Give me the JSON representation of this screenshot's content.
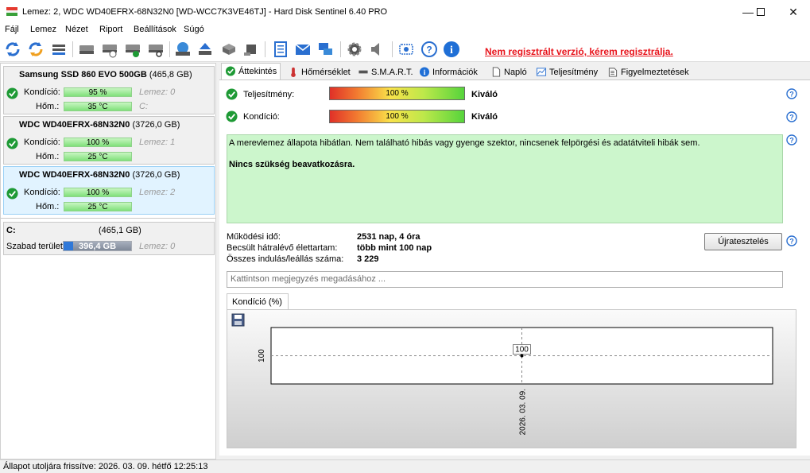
{
  "window": {
    "title": "Lemez: 2, WDC WD40EFRX-68N32N0 [WD-WCC7K3VE46TJ]  -  Hard Disk Sentinel 6.40 PRO"
  },
  "menu": [
    {
      "label": "Fájl"
    },
    {
      "label": "Lemez"
    },
    {
      "label": "Nézet"
    },
    {
      "label": "Riport"
    },
    {
      "label": "Beállítások"
    },
    {
      "label": "Súgó"
    }
  ],
  "toolbar": {
    "unregistered": "Nem regisztrált verzió, kérem regisztrálja."
  },
  "disks": [
    {
      "name": "Samsung SSD 860 EVO 500GB",
      "size": "(465,8 GB)",
      "cond_label": "Kondíció:",
      "cond": "95 %",
      "cond_note": "Lemez: 0",
      "temp_label": "Hőm.:",
      "temp": "35 °C",
      "temp_note": "C:"
    },
    {
      "name": "WDC WD40EFRX-68N32N0",
      "size": "(3726,0 GB)",
      "cond_label": "Kondíció:",
      "cond": "100 %",
      "cond_note": "Lemez: 1",
      "temp_label": "Hőm.:",
      "temp": "25 °C",
      "temp_note": ""
    },
    {
      "name": "WDC WD40EFRX-68N32N0",
      "size": "(3726,0 GB)",
      "cond_label": "Kondíció:",
      "cond": "100 %",
      "cond_note": "Lemez: 2",
      "temp_label": "Hőm.:",
      "temp": "25 °C",
      "temp_note": ""
    }
  ],
  "partition": {
    "drive": "C:",
    "size": "(465,1 GB)",
    "free_label": "Szabad terület",
    "free": "396,4 GB",
    "note": "Lemez: 0"
  },
  "tabs": [
    {
      "label": "Áttekintés"
    },
    {
      "label": "Hőmérséklet"
    },
    {
      "label": "S.M.A.R.T."
    },
    {
      "label": "Információk"
    },
    {
      "label": "Napló"
    },
    {
      "label": "Teljesítmény"
    },
    {
      "label": "Figyelmeztetések"
    }
  ],
  "overview": {
    "perf_label": "Teljesítmény:",
    "perf_value": "100 %",
    "perf_rating": "Kiváló",
    "cond_label": "Kondíció:",
    "cond_value": "100 %",
    "cond_rating": "Kiváló",
    "status_text": "A merevlemez állapota hibátlan. Nem található hibás vagy gyenge szektor, nincsenek felpörgési és adatátviteli hibák sem.",
    "status_action": "Nincs szükség beavatkozásra.",
    "uptime_label": "Működési idő:",
    "uptime_value": "2531 nap, 4 óra",
    "remaining_label": "Becsült hátralévő élettartam:",
    "remaining_value": "több mint 100 nap",
    "starts_label": "Összes indulás/leállás száma:",
    "starts_value": "3 229",
    "retest_label": "Újratesztelés",
    "note_placeholder": "Kattintson megjegyzés megadásához ..."
  },
  "chart_tab": "Kondíció  (%)",
  "chart_data": {
    "type": "line",
    "x": [
      "2026. 03. 09."
    ],
    "series": [
      {
        "values": [
          100
        ]
      }
    ],
    "ytick": "100",
    "xtick": "2026. 03. 09.",
    "point_label": "100"
  },
  "statusbar": {
    "text": "Állapot utoljára frissítve: 2026. 03. 09. hétfő 12:25:13"
  },
  "colors": {
    "unregistered": "#e8141c",
    "status_bg": "#ccf6cc",
    "selected_disk": "#e1f3ff"
  }
}
